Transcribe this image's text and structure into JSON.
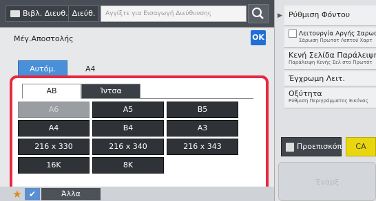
{
  "top_bar": {
    "address_book_tab": "Βιβλ. Διευθ.",
    "address_tab": "Διεύθ.",
    "address_placeholder": "Αγγίξτε για Εισαγωγή Διεύθυνσης",
    "search_icon": "search-icon"
  },
  "dialog": {
    "title": "Μέγ.Αποστολής",
    "ok": "OK",
    "auto_label": "Αυτόμ.",
    "current_size": "A4",
    "tabs": [
      "AB",
      "Ίντσα"
    ],
    "sizes": [
      "A6",
      "A5",
      "B5",
      "A4",
      "B4",
      "A3",
      "216 x 330",
      "216 x 340",
      "216 x 343",
      "16K",
      "8K"
    ],
    "disabled_size": "A6"
  },
  "right_panel": {
    "items": [
      {
        "title": "Ρύθμιση Φόντου"
      },
      {
        "title": "Λειτουργία Αργής Σαρωσης",
        "subtitle": "Σάρωση Πρωτοτ Λεπτού Χαρτ"
      },
      {
        "title": "Κενή Σελίδα Παράλειψη",
        "subtitle": "Παράλειψη Κενής Σελ στο Πρωτότ"
      },
      {
        "title": "Έγχρωμη Λειτ."
      },
      {
        "title": "Οξύτητα",
        "subtitle": "Ρύθμιση Περιγράμματος Εικόνας"
      }
    ],
    "preview_label": "Προεπισκόπ",
    "ca_label": "CA",
    "start_label": "Έναρξ"
  },
  "bottom_bar": {
    "other_label": "Άλλα"
  },
  "colors": {
    "highlight_border": "#e8283f",
    "ok_blue": "#1f6fd6",
    "ca_yellow": "#ead60e",
    "auto_blue": "#4a90d9"
  }
}
